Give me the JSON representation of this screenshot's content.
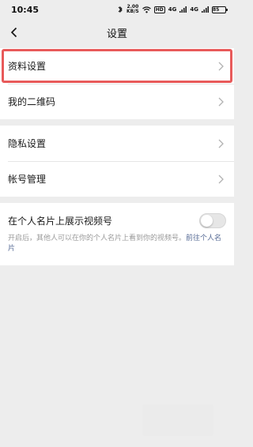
{
  "status_bar": {
    "time": "10:45",
    "speed_value": "2.00",
    "speed_unit": "KB/S",
    "hd_badge": "HD",
    "signal1": "4G",
    "signal2": "4G",
    "battery": "85"
  },
  "nav": {
    "title": "设置"
  },
  "groups": [
    {
      "items": [
        {
          "label": "资料设置"
        },
        {
          "label": "我的二维码"
        }
      ]
    },
    {
      "items": [
        {
          "label": "隐私设置"
        },
        {
          "label": "帐号管理"
        }
      ]
    }
  ],
  "toggle_setting": {
    "label": "在个人名片上展示视频号",
    "state": "off",
    "description": "开启后，其他人可以在你的个人名片上看到你的视频号。",
    "link": "前往个人名片"
  },
  "colors": {
    "background": "#ededed",
    "highlight_border": "#e85a5a",
    "link": "#576b95"
  }
}
